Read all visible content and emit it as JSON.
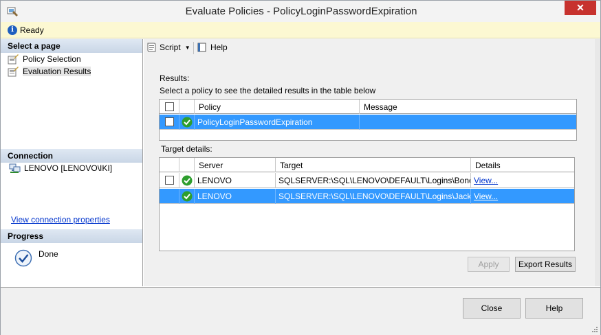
{
  "window": {
    "title": "Evaluate Policies - PolicyLoginPasswordExpiration",
    "close_glyph": "✕"
  },
  "status": {
    "text": "Ready"
  },
  "left": {
    "select_page_header": "Select a page",
    "pages": [
      {
        "label": "Policy Selection"
      },
      {
        "label": "Evaluation Results"
      }
    ],
    "connection_header": "Connection",
    "connection_name": "LENOVO [LENOVO\\IKI]",
    "view_connection_link": "View connection properties",
    "progress_header": "Progress",
    "progress_status": "Done"
  },
  "toolbar": {
    "script_label": "Script",
    "help_label": "Help"
  },
  "results": {
    "label": "Results:",
    "instruction": "Select a policy to see the detailed results in the table below",
    "columns": [
      "Policy",
      "Message"
    ],
    "rows": [
      {
        "policy": "PolicyLoginPasswordExpiration",
        "message": ""
      }
    ]
  },
  "targets": {
    "label": "Target details:",
    "columns": [
      "Server",
      "Target",
      "Details"
    ],
    "rows": [
      {
        "server": "LENOVO",
        "target": "SQLSERVER:\\SQL\\LENOVO\\DEFAULT\\Logins\\Bono",
        "details": "View..."
      },
      {
        "server": "LENOVO",
        "target": "SQLSERVER:\\SQL\\LENOVO\\DEFAULT\\Logins\\Jack",
        "details": "View..."
      }
    ]
  },
  "buttons": {
    "apply": "Apply",
    "export": "Export Results",
    "close": "Close",
    "help": "Help"
  },
  "colors": {
    "selection": "#3399ff",
    "link": "#0033cc",
    "status_bar": "#fcf8d2"
  }
}
